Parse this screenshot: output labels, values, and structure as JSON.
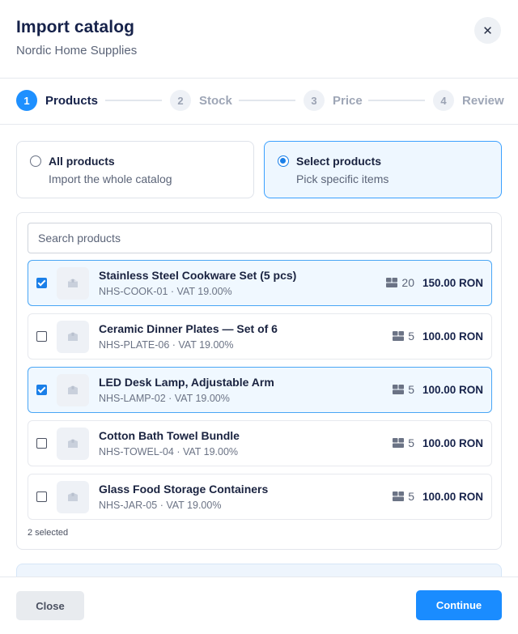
{
  "dialog": {
    "title": "Import catalog",
    "subtitle": "Nordic Home Supplies",
    "close_icon": "close-icon"
  },
  "stepper": {
    "steps": [
      {
        "number": "1",
        "label": "Products",
        "active": true
      },
      {
        "number": "2",
        "label": "Stock",
        "active": false
      },
      {
        "number": "3",
        "label": "Price",
        "active": false
      },
      {
        "number": "4",
        "label": "Review",
        "active": false
      }
    ]
  },
  "import_mode": {
    "options": [
      {
        "title": "All products",
        "description": "Import the whole catalog",
        "selected": false
      },
      {
        "title": "Select products",
        "description": "Pick specific items",
        "selected": true
      }
    ]
  },
  "product_list": {
    "search_placeholder": "Search products",
    "items": [
      {
        "name": "Stainless Steel Cookware Set (5 pcs)",
        "sku_vat": "NHS-COOK-01 · VAT 19.00%",
        "stock": "20",
        "price": "150.00 RON",
        "checked": true
      },
      {
        "name": "Ceramic Dinner Plates — Set of 6",
        "sku_vat": "NHS-PLATE-06 · VAT 19.00%",
        "stock": "5",
        "price": "100.00 RON",
        "checked": false
      },
      {
        "name": "LED Desk Lamp, Adjustable Arm",
        "sku_vat": "NHS-LAMP-02 · VAT 19.00%",
        "stock": "5",
        "price": "100.00 RON",
        "checked": true
      },
      {
        "name": "Cotton Bath Towel Bundle",
        "sku_vat": "NHS-TOWEL-04 · VAT 19.00%",
        "stock": "5",
        "price": "100.00 RON",
        "checked": false
      },
      {
        "name": "Glass Food Storage Containers",
        "sku_vat": "NHS-JAR-05 · VAT 19.00%",
        "stock": "5",
        "price": "100.00 RON",
        "checked": false
      }
    ],
    "selected_count": "2 selected"
  },
  "footer": {
    "close_label": "Close",
    "continue_label": "Continue"
  },
  "colors": {
    "accent": "#1a8cff",
    "title_text": "#16224a",
    "selected_border": "#3aa0ff"
  }
}
